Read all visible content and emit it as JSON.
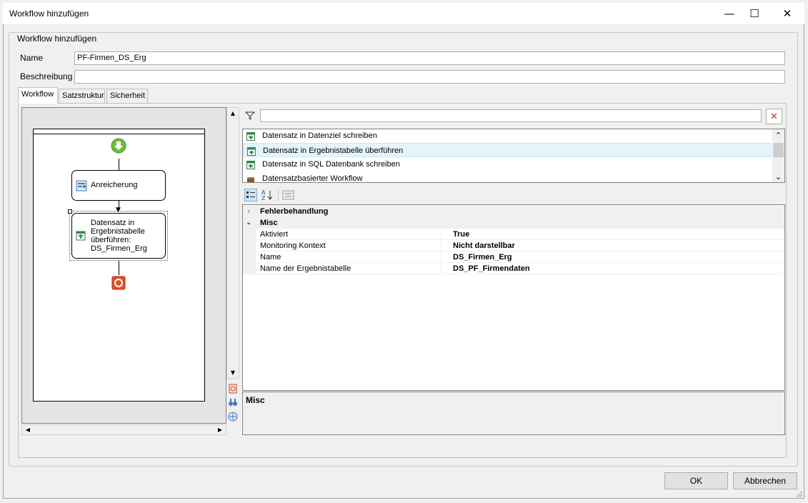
{
  "window": {
    "title": "Workflow hinzufügen",
    "minimize": "—",
    "maximize": "☐",
    "close": "✕"
  },
  "group_title": "Workflow hinzufügen",
  "form": {
    "name_label": "Name",
    "name_value": "PF-Firmen_DS_Erg",
    "desc_label": "Beschreibung",
    "desc_value": ""
  },
  "tabs": [
    "Workflow",
    "Satzstruktur",
    "Sicherheit"
  ],
  "designer": {
    "nodes": {
      "enrich": "Anreicherung",
      "transfer": "Datensatz in Ergebnistabelle überführen: DS_Firmen_Erg"
    }
  },
  "toolbox": {
    "filter_value": "",
    "items": [
      {
        "label": "Datensatz in Datenziel schreiben",
        "icon": "table-write-icon"
      },
      {
        "label": "Datensatz in Ergebnistabelle überführen",
        "icon": "table-transfer-icon"
      },
      {
        "label": "Datensatz in SQL Datenbank schreiben",
        "icon": "sql-write-icon"
      },
      {
        "label": "Datensatzbasierter Workflow",
        "icon": "workflow-box-icon"
      }
    ]
  },
  "properties": {
    "categories": [
      {
        "name": "Fehlerbehandlung",
        "expanded": false,
        "rows": []
      },
      {
        "name": "Misc",
        "expanded": true,
        "rows": [
          {
            "key": "Aktiviert",
            "value": "True"
          },
          {
            "key": "Monitoring Kontext",
            "value": "Nicht darstellbar"
          },
          {
            "key": "Name",
            "value": "DS_Firmen_Erg"
          },
          {
            "key": "Name der Ergebnistabelle",
            "value": "DS_PF_Firmendaten"
          }
        ]
      }
    ],
    "description_title": "Misc"
  },
  "buttons": {
    "ok": "OK",
    "cancel": "Abbrechen"
  }
}
